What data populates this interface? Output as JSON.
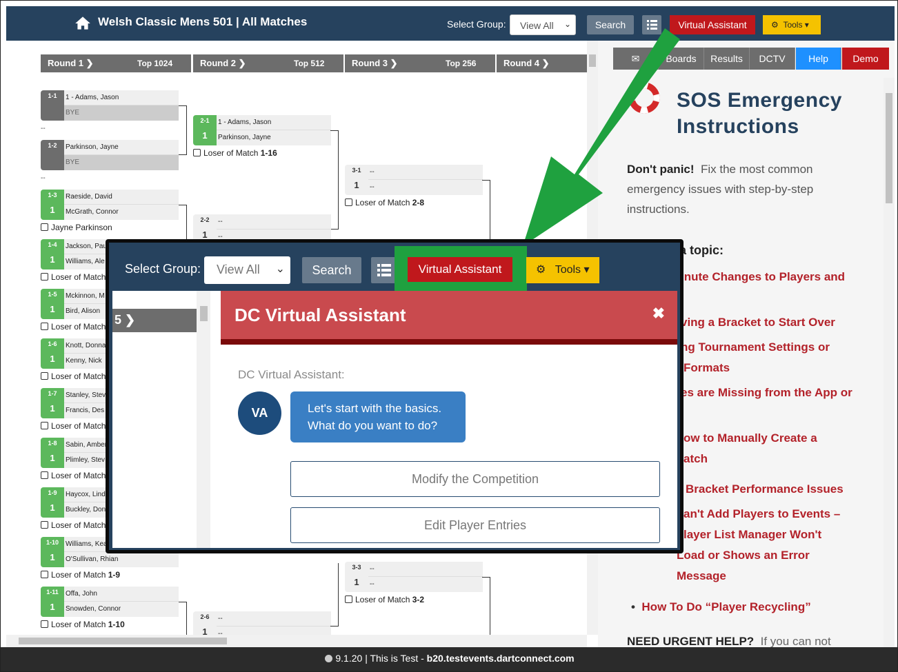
{
  "topbar": {
    "title": "Welsh Classic Mens 501 | All Matches",
    "select_group_label": "Select Group:",
    "select_value": "View All",
    "search": "Search",
    "virtual_assistant": "Virtual Assistant",
    "tools": "Tools"
  },
  "rounds": [
    {
      "label": "Round 1",
      "count": "Top 1024"
    },
    {
      "label": "Round 2",
      "count": "Top 512"
    },
    {
      "label": "Round 3",
      "count": "Top 256"
    },
    {
      "label": "Round 4",
      "count": ""
    }
  ],
  "round1": [
    {
      "id": "1-1",
      "score": "",
      "p1": "1 - Adams, Jason",
      "p2": "BYE",
      "loser": "",
      "grey": true
    },
    {
      "id": "1-2",
      "score": "",
      "p1": "Parkinson, Jayne",
      "p2": "BYE",
      "loser": "",
      "grey": true
    },
    {
      "id": "1-3",
      "score": "1",
      "p1": "Raeside, David",
      "p2": "McGrath, Connor",
      "loser": "Jayne Parkinson"
    },
    {
      "id": "1-4",
      "score": "1",
      "p1": "Jackson, Pau",
      "p2": "Williams, Ale",
      "loser": "Loser of Match"
    },
    {
      "id": "1-5",
      "score": "1",
      "p1": "Mckinnon, M",
      "p2": "Bird, Alison",
      "loser": "Loser of Match"
    },
    {
      "id": "1-6",
      "score": "1",
      "p1": "Knott, Donna",
      "p2": "Kenny, Nick",
      "loser": "Loser of Match"
    },
    {
      "id": "1-7",
      "score": "1",
      "p1": "Stanley, Stev",
      "p2": "Francis, Des",
      "loser": "Loser of Match"
    },
    {
      "id": "1-8",
      "score": "1",
      "p1": "Sabin, Amber",
      "p2": "Plimley, Stev",
      "loser": "Loser of Match"
    },
    {
      "id": "1-9",
      "score": "1",
      "p1": "Haycox, Lind",
      "p2": "Buckley, Don",
      "loser": "Loser of Match"
    },
    {
      "id": "1-10",
      "score": "1",
      "p1": "Williams, Kea",
      "p2": "O'Sullivan, Rhian",
      "loser": "Loser of Match",
      "loser_ref": "1-9"
    },
    {
      "id": "1-11",
      "score": "1",
      "p1": "Offa, John",
      "p2": "Snowden, Connor",
      "loser": "Loser of Match",
      "loser_ref": "1-10"
    }
  ],
  "round2": [
    {
      "id": "2-1",
      "score": "1",
      "p1": "1 - Adams, Jason",
      "p2": "Parkinson, Jayne",
      "loser": "Loser of Match",
      "loser_ref": "1-16"
    },
    {
      "id": "2-2",
      "score": "1",
      "p1": "--",
      "p2": "--"
    },
    {
      "id": "2-6",
      "score": "1",
      "p1": "--",
      "p2": "--"
    }
  ],
  "round3": [
    {
      "id": "3-1",
      "score": "1",
      "p1": "--",
      "p2": "--",
      "loser": "Loser of Match",
      "loser_ref": "2-8"
    },
    {
      "id": "3-3",
      "score": "1",
      "p1": "--",
      "p2": "--",
      "loser": "Loser of Match",
      "loser_ref": "3-2"
    }
  ],
  "bye_separator": "--",
  "right_nav": [
    "Boards",
    "Results",
    "DCTV",
    "Help",
    "Demo"
  ],
  "sos": {
    "title_line1": "SOS Emergency",
    "title_line2": "Instructions",
    "intro_bold": "Don't panic!",
    "intro": "Fix the most common emergency issues with step-by-step instructions.",
    "choose": "a topic:",
    "links": [
      "inute Changes to Players and",
      "ving a Bracket to Start Over",
      "ng Tournament Settings or",
      "Formats",
      "es are Missing from the App or",
      "ow to Manually Create a",
      "atch",
      "Bracket Performance Issues",
      "an't Add Players to Events –",
      "layer List Manager Won't",
      "Load or Shows an Error",
      "Message",
      "How To Do “Player Recycling”"
    ],
    "urgent_bold": "NEED URGENT HELP?",
    "urgent": "If you can not"
  },
  "footer": {
    "version": "9.1.20",
    "sep": "| This is Test -",
    "host": "b20.testevents.dartconnect.com"
  },
  "popup": {
    "select_group_label": "Select Group:",
    "select_value": "View All",
    "search": "Search",
    "virtual_assistant": "Virtual Assistant",
    "tools": "Tools",
    "round_label": "5",
    "dialog_title": "DC Virtual Assistant",
    "speaker": "DC Virtual Assistant:",
    "avatar": "VA",
    "message": "Let's start with the basics. What do you want to do?",
    "options": [
      "Modify the Competition",
      "Edit Player Entries"
    ]
  },
  "colors": {
    "navy": "#26425e",
    "red": "#c0181c",
    "yellow": "#f5c200",
    "green": "#5cb85c",
    "arrow_green": "#1fa13f",
    "link_red": "#b3222a"
  }
}
